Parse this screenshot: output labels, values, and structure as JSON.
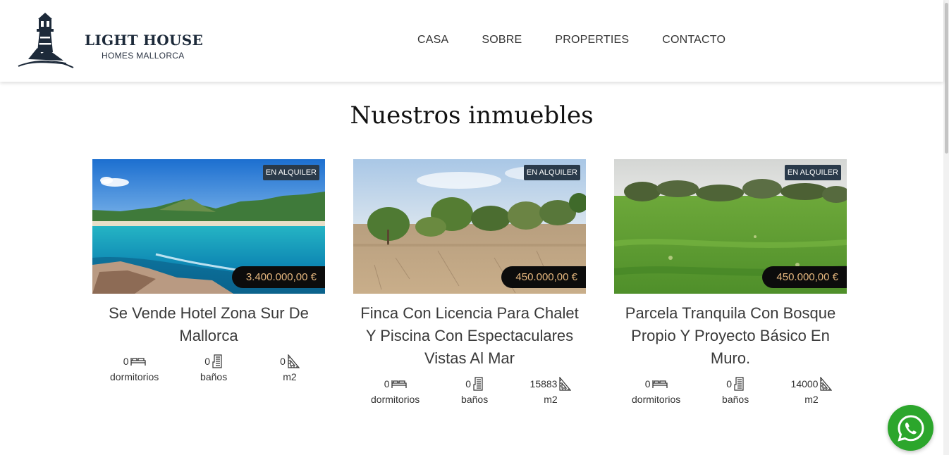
{
  "brand": {
    "title": "LIGHT HOUSE",
    "subtitle": "HOMES MALLORCA"
  },
  "nav": {
    "items": [
      {
        "label": "CASA"
      },
      {
        "label": "SOBRE"
      },
      {
        "label": "PROPERTIES"
      },
      {
        "label": "CONTACTO"
      }
    ]
  },
  "page": {
    "heading": "Nuestros inmuebles"
  },
  "properties": [
    {
      "badge": "EN ALQUILER",
      "price": "3.400.000,00 €",
      "title": "Se Vende Hotel Zona Sur De Mallorca",
      "bedrooms": "0",
      "bathrooms": "0",
      "area": "0"
    },
    {
      "badge": "EN ALQUILER",
      "price": "450.000,00 €",
      "title": "Finca Con Licencia Para Chalet Y Piscina Con Espectaculares Vistas Al Mar",
      "bedrooms": "0",
      "bathrooms": "0",
      "area": "15883"
    },
    {
      "badge": "EN ALQUILER",
      "price": "450.000,00 €",
      "title": "Parcela Tranquila Con Bosque Propio Y Proyecto Básico En Muro.",
      "bedrooms": "0",
      "bathrooms": "0",
      "area": "14000"
    }
  ],
  "labels": {
    "bedrooms": "dormitorios",
    "bathrooms": "baños",
    "area": "m2"
  },
  "icons": {
    "logo": "lighthouse-icon",
    "bed": "bed-icon",
    "bath": "bath-icon",
    "area": "area-icon",
    "whatsapp": "whatsapp-icon"
  },
  "colors": {
    "brand": "#1d2a3a",
    "badge": "#2a3a4a",
    "price_text": "#e6b77e",
    "whatsapp": "#2ca62c"
  }
}
